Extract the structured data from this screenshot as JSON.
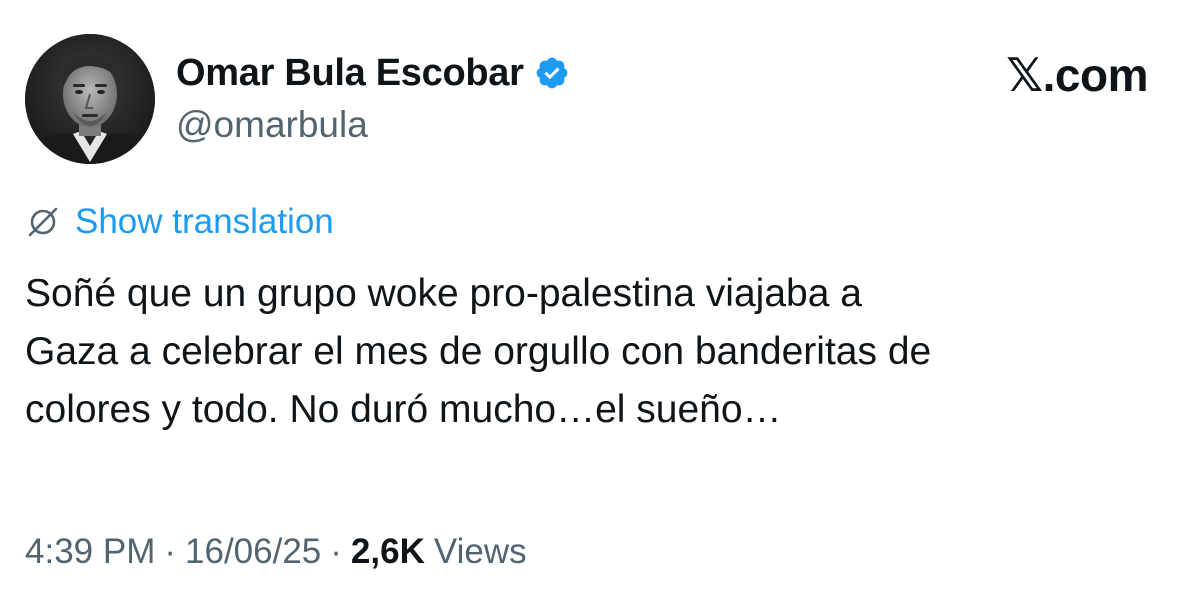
{
  "author": {
    "display_name": "Omar Bula Escobar",
    "handle": "@omarbula",
    "verified_icon": "verified-badge-icon",
    "verified_color": "#1d9bf0"
  },
  "source": {
    "logo_text": "𝕏.com"
  },
  "translation": {
    "icon": "translate-icon",
    "link_label": "Show translation",
    "link_color": "#1d9bf0"
  },
  "tweet": {
    "lines": [
      "Soñé que un grupo woke pro-palestina viajaba a",
      "Gaza a celebrar el mes de orgullo con banderitas de",
      "colores y todo. No duró mucho…el sueño…"
    ]
  },
  "meta": {
    "time": "4:39 PM",
    "separator": "·",
    "date": "16/06/25",
    "views_count": "2,6K",
    "views_label": "Views"
  },
  "colors": {
    "text_primary": "#0f1419",
    "text_secondary": "#536471",
    "accent": "#1d9bf0"
  }
}
